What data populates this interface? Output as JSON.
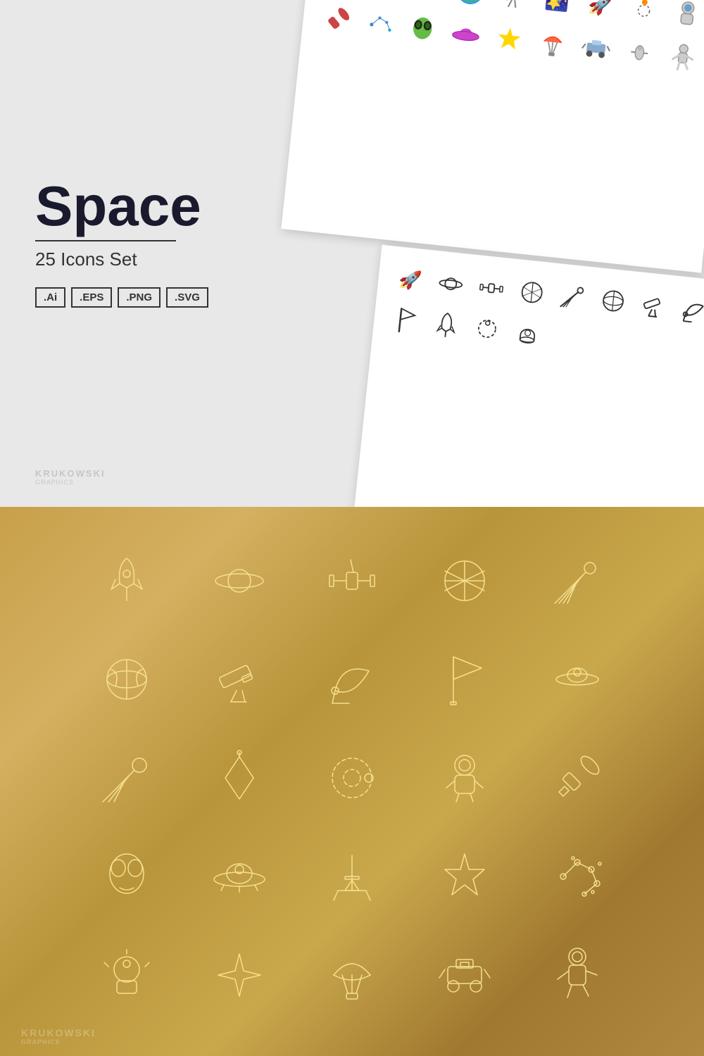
{
  "title": "Space",
  "subtitle": "25 Icons Set",
  "formats": [
    ".Ai",
    ".EPS",
    ".PNG",
    ".SVG"
  ],
  "brand": "KRUKOWSKI",
  "brand_sub": "graphics",
  "colors": {
    "accent_gold": "#f5e090",
    "gradient_start": "#c8a04a",
    "gradient_end": "#a07830"
  }
}
